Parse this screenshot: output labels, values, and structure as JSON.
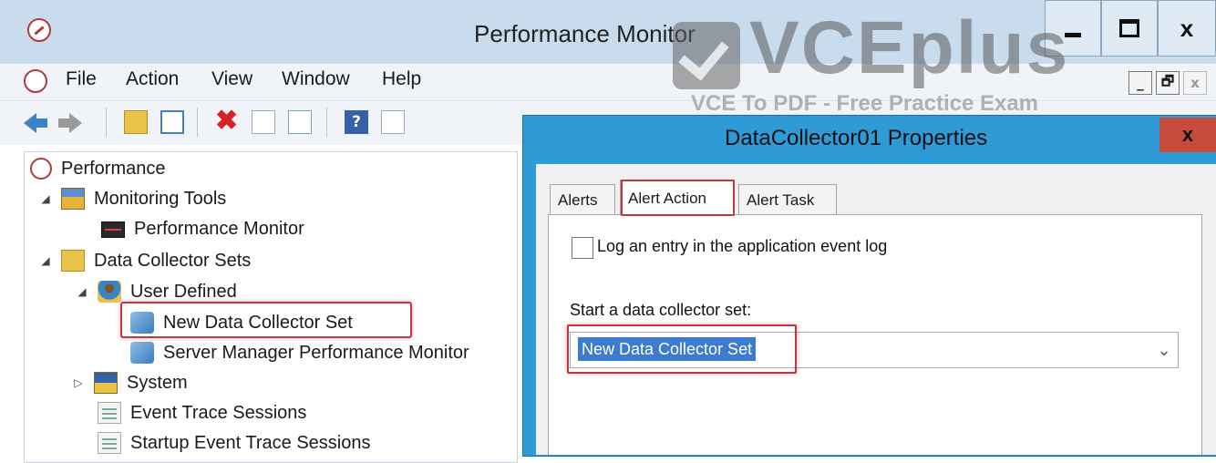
{
  "window": {
    "title": "Performance Monitor",
    "minimize_label": "",
    "close_glyph": "x"
  },
  "menu": {
    "items": [
      "File",
      "Action",
      "View",
      "Window",
      "Help"
    ],
    "mdi_minimize": "_",
    "mdi_restore": "🗗",
    "mdi_close": "x"
  },
  "toolbar": {
    "icons": [
      "back-arrow-icon",
      "forward-arrow-icon",
      "up-folder-icon",
      "show-hide-tree-icon",
      "delete-icon",
      "properties-icon",
      "export-list-icon",
      "help-icon",
      "view-icon"
    ],
    "delete_glyph": "✖",
    "help_glyph": "?"
  },
  "tree": {
    "root": "Performance",
    "monitoring_tools": "Monitoring Tools",
    "performance_monitor": "Performance Monitor",
    "data_collector_sets": "Data Collector Sets",
    "user_defined": "User Defined",
    "new_data_collector_set": "New Data Collector Set",
    "server_manager_set": "Server Manager Performance Monitor",
    "system": "System",
    "event_trace_sessions": "Event Trace Sessions",
    "startup_event_trace_sessions": "Startup Event Trace Sessions",
    "expanded_glyph": "◢",
    "collapsed_glyph": "▷"
  },
  "dialog": {
    "title": "DataCollector01 Properties",
    "close_glyph": "x",
    "tabs": [
      "Alerts",
      "Alert Action",
      "Alert Task"
    ],
    "active_tab": "Alert Action",
    "log_checkbox_label": "Log an entry in the application event log",
    "log_checkbox_checked": false,
    "start_set_label": "Start a data collector set:",
    "start_set_value": "New Data Collector Set",
    "dropdown_glyph": "⌄"
  },
  "watermark": {
    "brand": "VCEplus",
    "tagline": "VCE To PDF - Free Practice Exam"
  },
  "colors": {
    "highlight": "#c0373c",
    "dialog_frame": "#2e9ad6",
    "selection": "#3d7bd1"
  }
}
